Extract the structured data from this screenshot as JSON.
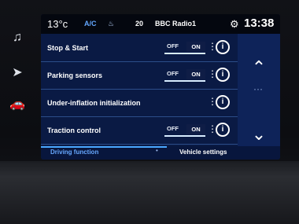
{
  "status": {
    "outside_temp": "13°c",
    "ac_label": "A/C",
    "seat_icon": "seat-heat-icon",
    "temp_setting": "20",
    "radio": "BBC Radio1",
    "time": "13:38"
  },
  "list": {
    "rows": [
      {
        "label": "Stop & Start",
        "toggle_off": "OFF",
        "toggle_on": "ON"
      },
      {
        "label": "Parking sensors",
        "toggle_off": "OFF",
        "toggle_on": "ON"
      },
      {
        "label": "Under-inflation initialization"
      },
      {
        "label": "Traction control",
        "toggle_off": "OFF",
        "toggle_on": "ON"
      }
    ]
  },
  "tabs": {
    "driving_function": "Driving function",
    "vehicle_settings": "Vehicle settings"
  }
}
